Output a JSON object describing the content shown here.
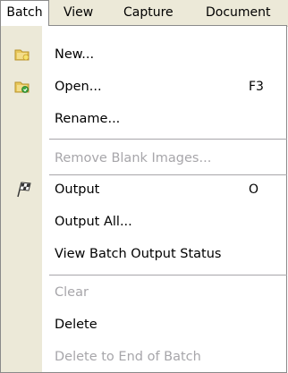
{
  "menubar": {
    "items": [
      {
        "label": "Batch"
      },
      {
        "label": "View"
      },
      {
        "label": "Capture"
      },
      {
        "label": "Document"
      }
    ]
  },
  "dropdown": {
    "items": [
      {
        "label": "New...",
        "shortcut": "",
        "icon": "new-batch-icon",
        "enabled": true
      },
      {
        "label": "Open...",
        "shortcut": "F3",
        "icon": "open-batch-icon",
        "enabled": true
      },
      {
        "label": "Rename...",
        "shortcut": "",
        "icon": "",
        "enabled": true
      },
      {
        "label": "Remove Blank Images...",
        "shortcut": "",
        "icon": "",
        "enabled": false
      },
      {
        "label": "Output",
        "shortcut": "O",
        "icon": "checkered-flag-icon",
        "enabled": true
      },
      {
        "label": "Output All...",
        "shortcut": "",
        "icon": "",
        "enabled": true
      },
      {
        "label": "View Batch Output Status",
        "shortcut": "",
        "icon": "",
        "enabled": true
      },
      {
        "label": "Clear",
        "shortcut": "",
        "icon": "",
        "enabled": false
      },
      {
        "label": "Delete",
        "shortcut": "",
        "icon": "",
        "enabled": true
      },
      {
        "label": "Delete to End of Batch",
        "shortcut": "",
        "icon": "",
        "enabled": false
      }
    ]
  },
  "colors": {
    "menubar_bg": "#ece9d8",
    "disabled_text": "#a7a6aa"
  }
}
